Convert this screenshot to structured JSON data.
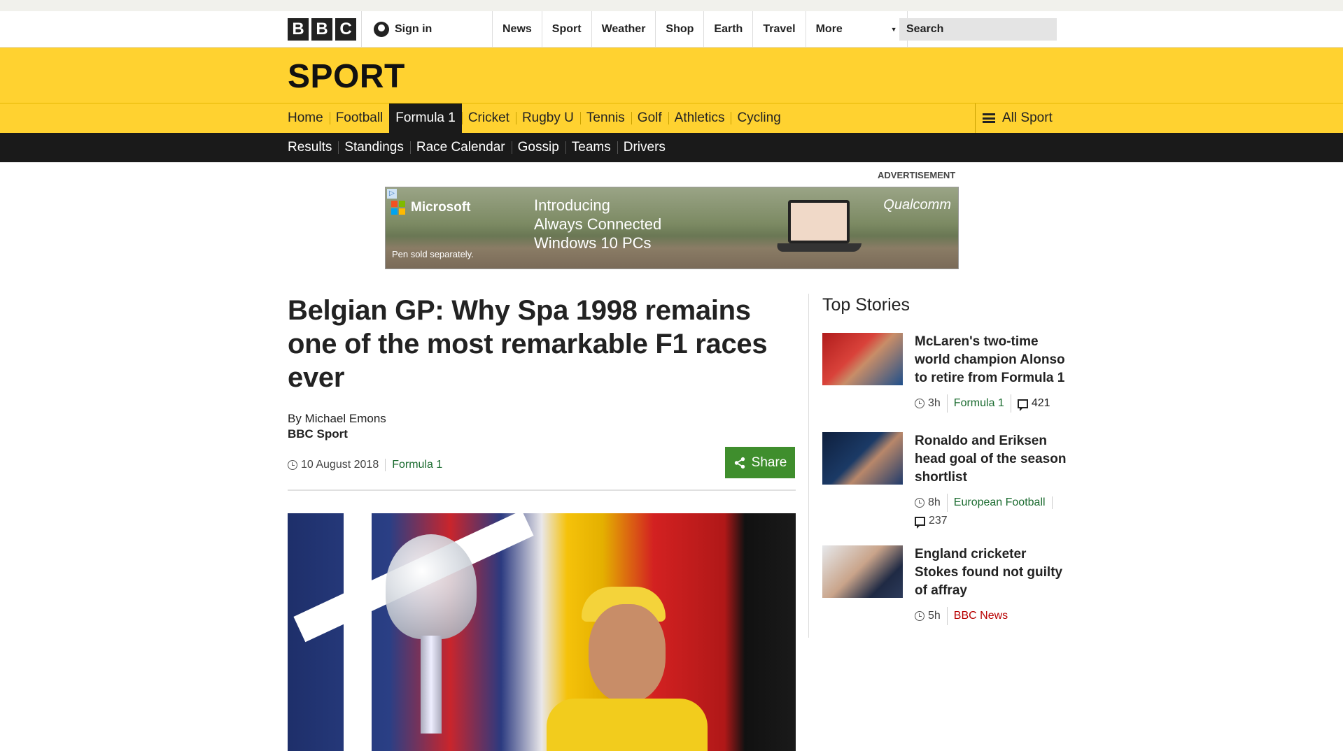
{
  "global_nav": {
    "logo_letters": [
      "B",
      "B",
      "C"
    ],
    "sign_in": "Sign in",
    "links": [
      "News",
      "Sport",
      "Weather",
      "Shop",
      "Earth",
      "Travel"
    ],
    "more": "More",
    "search_placeholder": "Search"
  },
  "sport": {
    "title": "SPORT",
    "nav": [
      "Home",
      "Football",
      "Formula 1",
      "Cricket",
      "Rugby U",
      "Tennis",
      "Golf",
      "Athletics",
      "Cycling"
    ],
    "active_nav": "Formula 1",
    "all_sport": "All Sport",
    "subnav": [
      "Results",
      "Standings",
      "Race Calendar",
      "Gossip",
      "Teams",
      "Drivers"
    ]
  },
  "ad": {
    "label": "ADVERTISEMENT",
    "brand": "Microsoft",
    "headline_lines": [
      "Introducing",
      "Always Connected",
      "Windows 10 PCs"
    ],
    "footnote": "Pen sold separately.",
    "partner": "Qualcomm"
  },
  "article": {
    "headline": "Belgian GP: Why Spa 1998 remains one of the most remarkable F1 races ever",
    "author": "By Michael Emons",
    "org": "BBC Sport",
    "date": "10 August 2018",
    "category": "Formula 1",
    "share_label": "Share"
  },
  "top_stories": {
    "heading": "Top Stories",
    "items": [
      {
        "title": "McLaren's two-time world champion Alonso to retire from Formula 1",
        "time": "3h",
        "category": "Formula 1",
        "category_color": "#1a6b2f",
        "comments": "421"
      },
      {
        "title": "Ronaldo and Eriksen head goal of the season shortlist",
        "time": "8h",
        "category": "European Football",
        "category_color": "#1a6b2f",
        "comments": "237"
      },
      {
        "title": "England cricketer Stokes found not guilty of affray",
        "time": "5h",
        "category": "BBC News",
        "category_color": "#b80000",
        "comments": ""
      }
    ]
  },
  "colors": {
    "sport_yellow": "#ffd230",
    "subnav_black": "#1a1a1a",
    "share_green": "#3f8e2d"
  }
}
